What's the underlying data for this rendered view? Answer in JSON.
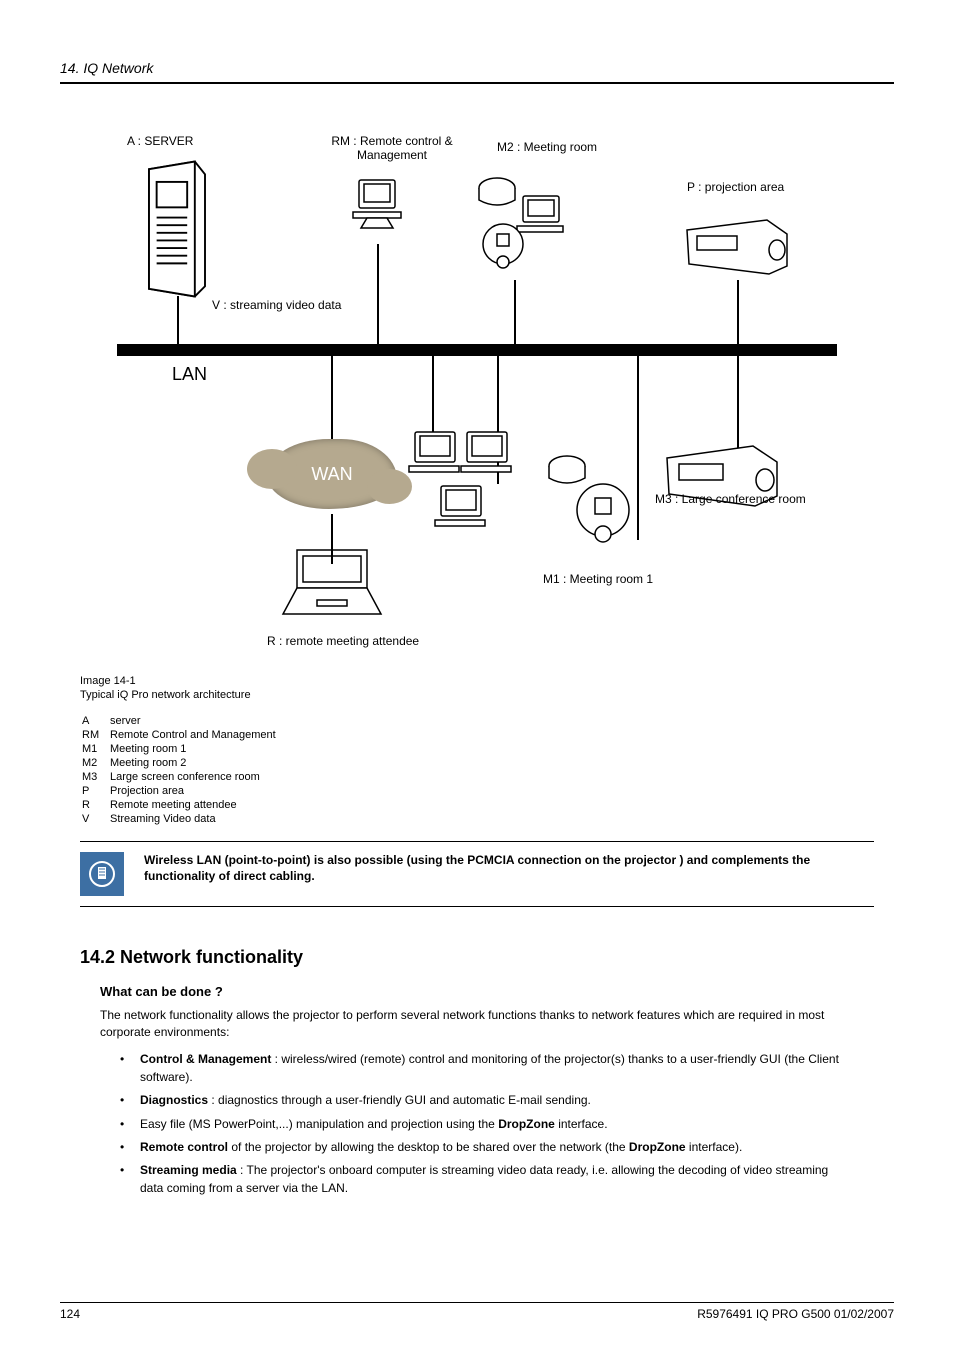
{
  "header": {
    "chapter_title": "14. IQ Network"
  },
  "diagram": {
    "labels": {
      "server": "A : SERVER",
      "remote_mgmt": "RM : Remote control & Management",
      "m2": "M2 : Meeting room",
      "projection": "P : projection area",
      "video": "V : streaming video data",
      "lan": "LAN",
      "wan": "WAN",
      "m1": "M1 : Meeting room 1",
      "m3": "M3 : Large conference room",
      "remote_attendee": "R : remote meeting attendee"
    }
  },
  "caption": {
    "id": "Image 14-1",
    "text": "Typical iQ Pro network architecture"
  },
  "legend": [
    {
      "k": "A",
      "v": "server"
    },
    {
      "k": "RM",
      "v": "Remote Control and Management"
    },
    {
      "k": "M1",
      "v": "Meeting room 1"
    },
    {
      "k": "M2",
      "v": "Meeting room 2"
    },
    {
      "k": "M3",
      "v": "Large screen conference room"
    },
    {
      "k": "P",
      "v": "Projection area"
    },
    {
      "k": "R",
      "v": "Remote meeting attendee"
    },
    {
      "k": "V",
      "v": "Streaming Video data"
    }
  ],
  "note": {
    "text": "Wireless LAN (point-to-point) is also possible (using the PCMCIA connection on the projector ) and complements the functionality of direct cabling."
  },
  "section": {
    "number_title": "14.2  Network functionality",
    "sub": "What can be done ?",
    "intro": "The network functionality allows the projector to perform several network functions thanks to network features which are required in most corporate environments:",
    "bullets": [
      {
        "bold": "Control & Management",
        "rest": " : wireless/wired (remote) control and monitoring of the projector(s) thanks to a user-friendly GUI (the Client software)."
      },
      {
        "bold": "Diagnostics",
        "rest": " : diagnostics through a user-friendly GUI and automatic E-mail sending."
      },
      {
        "plain_pre": "Easy file (MS PowerPoint,...)  manipulation and projection using the ",
        "bold": "DropZone",
        "plain_post": " interface."
      },
      {
        "bold": "Remote control",
        "rest_pre": " of the projector by allowing the desktop to be shared over the network (the ",
        "bold2": "DropZone",
        "rest_post": " interface)."
      },
      {
        "bold": "Streaming media",
        "rest": " : The projector's onboard computer is streaming video data ready, i.e. allowing the decoding of video streaming data coming from a server via the LAN."
      }
    ]
  },
  "footer": {
    "page": "124",
    "doc": "R5976491  IQ PRO G500  01/02/2007"
  }
}
